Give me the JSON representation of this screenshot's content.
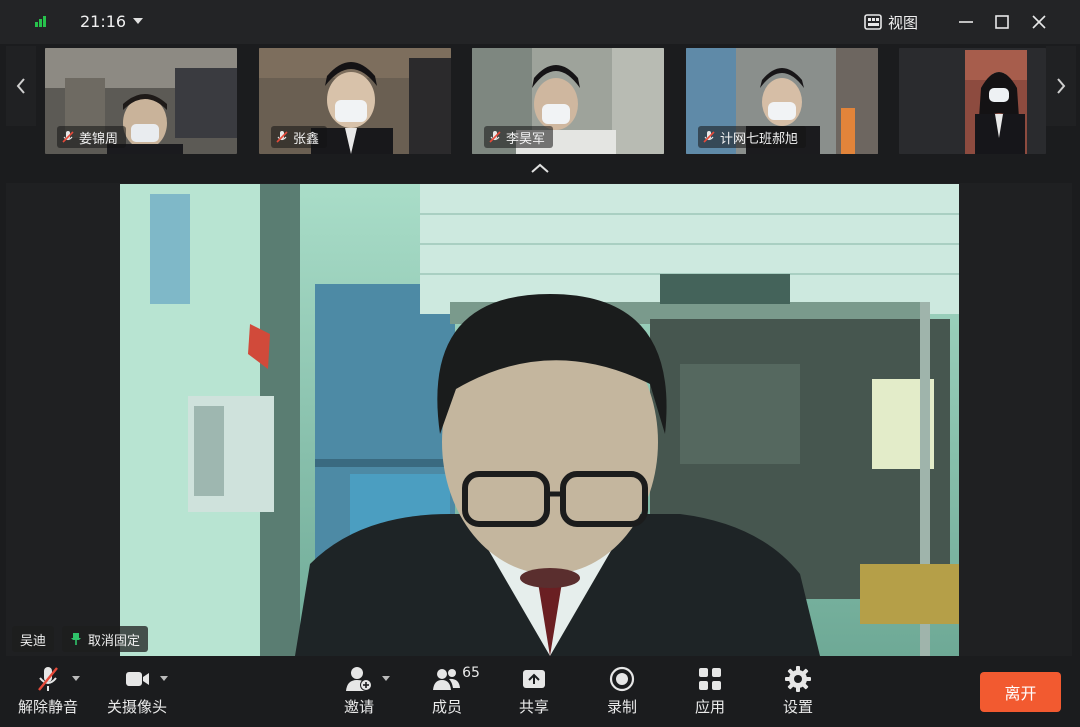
{
  "titlebar": {
    "time": "21:16",
    "view_label": "视图",
    "icons": [
      "signal-icon",
      "caret-down-icon",
      "grid-view-icon",
      "minimize-icon",
      "maximize-icon",
      "close-icon"
    ]
  },
  "participants": [
    {
      "name": "姜锦周",
      "muted": true
    },
    {
      "name": "张鑫",
      "muted": true
    },
    {
      "name": "李昊军",
      "muted": true
    },
    {
      "name": "计网七班郝旭",
      "muted": true
    },
    {
      "name": "",
      "muted": false
    }
  ],
  "main_video": {
    "speaker_name": "吴迪",
    "unpin_label": "取消固定"
  },
  "toolbar": {
    "unmute_label": "解除静音",
    "camera_label": "关摄像头",
    "invite_label": "邀请",
    "members_label": "成员",
    "members_count": "65",
    "share_label": "共享",
    "record_label": "录制",
    "apps_label": "应用",
    "settings_label": "设置",
    "leave_label": "离开"
  },
  "colors": {
    "background": "#1b1c1e",
    "leave_button": "#f25a30",
    "signal": "#27c24c",
    "muted_icon": "#e64a3a",
    "pin_icon": "#2fc36a"
  }
}
